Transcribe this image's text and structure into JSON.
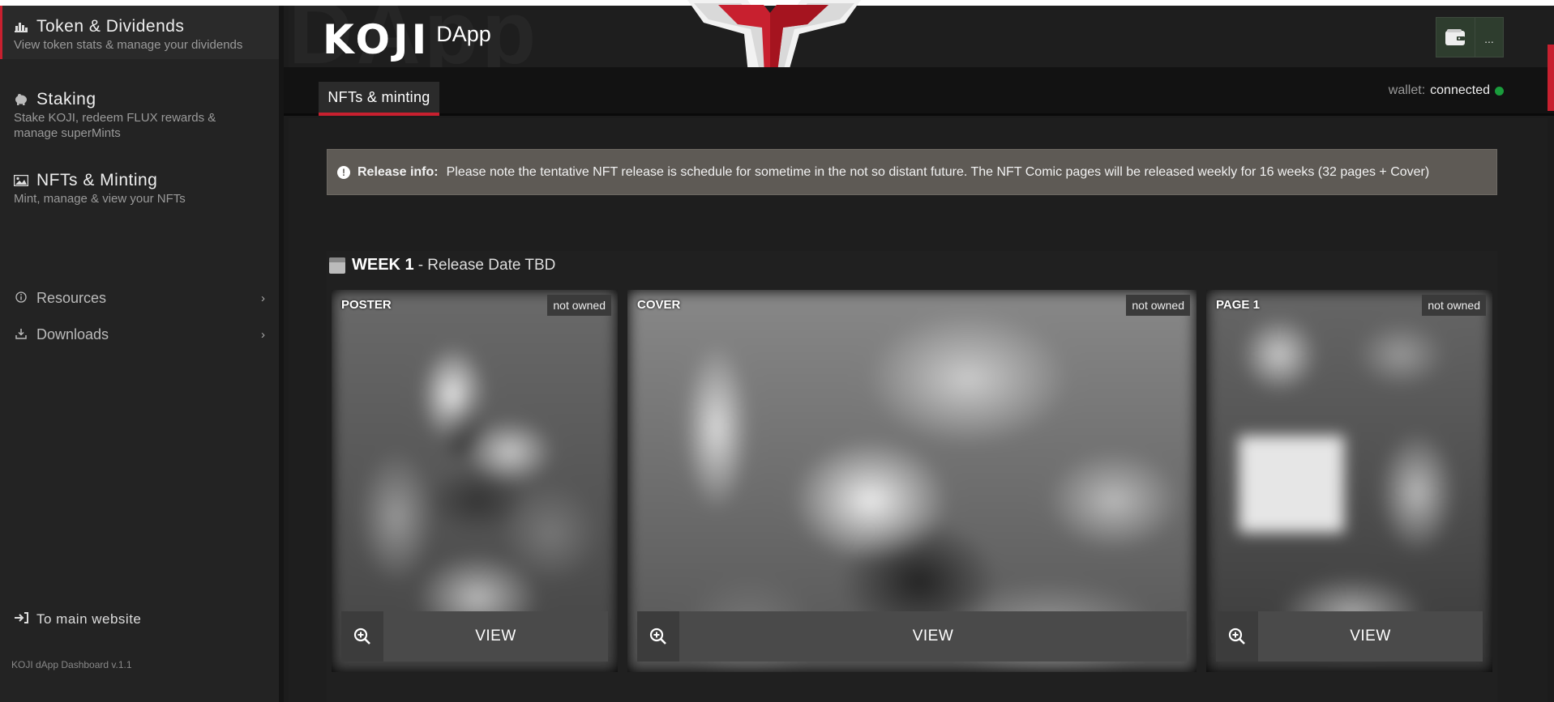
{
  "sidebar": {
    "items": [
      {
        "label": "Token & Dividends",
        "desc": "View token stats & manage your dividends",
        "icon": "bar-chart-icon"
      },
      {
        "label": "Staking",
        "desc": "Stake KOJI, redeem FLUX rewards & manage superMints",
        "icon": "piggy-bank-icon"
      },
      {
        "label": "NFTs & Minting",
        "desc": "Mint, manage & view your NFTs",
        "icon": "image-icon"
      }
    ],
    "links": [
      {
        "label": "Resources",
        "icon": "info-icon"
      },
      {
        "label": "Downloads",
        "icon": "download-icon"
      }
    ],
    "to_main": "To main website",
    "version": "KOJI dApp Dashboard v.1.1"
  },
  "header": {
    "brand": "KOJI",
    "brand_sub": "DApp",
    "watermark": "DApp",
    "wallet_more": "..."
  },
  "tabs": {
    "active": "NFTs & minting",
    "wallet_label": "wallet:",
    "wallet_status": "connected"
  },
  "release": {
    "label": "Release info:",
    "text": "Please note the tentative NFT release is schedule for sometime in the not so distant future. The NFT Comic pages will be released weekly for 16 weeks (32 pages + Cover)"
  },
  "week": {
    "title": "WEEK 1",
    "subtitle": "- Release Date TBD"
  },
  "cards": [
    {
      "label": "POSTER",
      "badge": "not owned",
      "button": "VIEW"
    },
    {
      "label": "COVER",
      "badge": "not owned",
      "button": "VIEW"
    },
    {
      "label": "PAGE 1",
      "badge": "not owned",
      "button": "VIEW"
    }
  ],
  "colors": {
    "accent": "#c8202f",
    "status_connected": "#1a9c3c",
    "release_bg": "#5e5a55"
  }
}
